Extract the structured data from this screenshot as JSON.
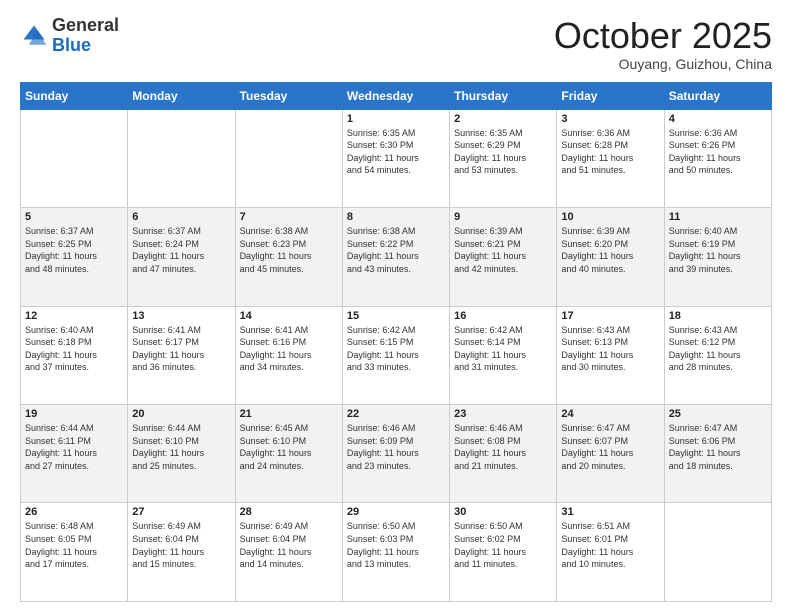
{
  "logo": {
    "general": "General",
    "blue": "Blue"
  },
  "header": {
    "month": "October 2025",
    "location": "Ouyang, Guizhou, China"
  },
  "days_of_week": [
    "Sunday",
    "Monday",
    "Tuesday",
    "Wednesday",
    "Thursday",
    "Friday",
    "Saturday"
  ],
  "weeks": [
    [
      {
        "day": "",
        "info": ""
      },
      {
        "day": "",
        "info": ""
      },
      {
        "day": "",
        "info": ""
      },
      {
        "day": "1",
        "info": "Sunrise: 6:35 AM\nSunset: 6:30 PM\nDaylight: 11 hours\nand 54 minutes."
      },
      {
        "day": "2",
        "info": "Sunrise: 6:35 AM\nSunset: 6:29 PM\nDaylight: 11 hours\nand 53 minutes."
      },
      {
        "day": "3",
        "info": "Sunrise: 6:36 AM\nSunset: 6:28 PM\nDaylight: 11 hours\nand 51 minutes."
      },
      {
        "day": "4",
        "info": "Sunrise: 6:36 AM\nSunset: 6:26 PM\nDaylight: 11 hours\nand 50 minutes."
      }
    ],
    [
      {
        "day": "5",
        "info": "Sunrise: 6:37 AM\nSunset: 6:25 PM\nDaylight: 11 hours\nand 48 minutes."
      },
      {
        "day": "6",
        "info": "Sunrise: 6:37 AM\nSunset: 6:24 PM\nDaylight: 11 hours\nand 47 minutes."
      },
      {
        "day": "7",
        "info": "Sunrise: 6:38 AM\nSunset: 6:23 PM\nDaylight: 11 hours\nand 45 minutes."
      },
      {
        "day": "8",
        "info": "Sunrise: 6:38 AM\nSunset: 6:22 PM\nDaylight: 11 hours\nand 43 minutes."
      },
      {
        "day": "9",
        "info": "Sunrise: 6:39 AM\nSunset: 6:21 PM\nDaylight: 11 hours\nand 42 minutes."
      },
      {
        "day": "10",
        "info": "Sunrise: 6:39 AM\nSunset: 6:20 PM\nDaylight: 11 hours\nand 40 minutes."
      },
      {
        "day": "11",
        "info": "Sunrise: 6:40 AM\nSunset: 6:19 PM\nDaylight: 11 hours\nand 39 minutes."
      }
    ],
    [
      {
        "day": "12",
        "info": "Sunrise: 6:40 AM\nSunset: 6:18 PM\nDaylight: 11 hours\nand 37 minutes."
      },
      {
        "day": "13",
        "info": "Sunrise: 6:41 AM\nSunset: 6:17 PM\nDaylight: 11 hours\nand 36 minutes."
      },
      {
        "day": "14",
        "info": "Sunrise: 6:41 AM\nSunset: 6:16 PM\nDaylight: 11 hours\nand 34 minutes."
      },
      {
        "day": "15",
        "info": "Sunrise: 6:42 AM\nSunset: 6:15 PM\nDaylight: 11 hours\nand 33 minutes."
      },
      {
        "day": "16",
        "info": "Sunrise: 6:42 AM\nSunset: 6:14 PM\nDaylight: 11 hours\nand 31 minutes."
      },
      {
        "day": "17",
        "info": "Sunrise: 6:43 AM\nSunset: 6:13 PM\nDaylight: 11 hours\nand 30 minutes."
      },
      {
        "day": "18",
        "info": "Sunrise: 6:43 AM\nSunset: 6:12 PM\nDaylight: 11 hours\nand 28 minutes."
      }
    ],
    [
      {
        "day": "19",
        "info": "Sunrise: 6:44 AM\nSunset: 6:11 PM\nDaylight: 11 hours\nand 27 minutes."
      },
      {
        "day": "20",
        "info": "Sunrise: 6:44 AM\nSunset: 6:10 PM\nDaylight: 11 hours\nand 25 minutes."
      },
      {
        "day": "21",
        "info": "Sunrise: 6:45 AM\nSunset: 6:10 PM\nDaylight: 11 hours\nand 24 minutes."
      },
      {
        "day": "22",
        "info": "Sunrise: 6:46 AM\nSunset: 6:09 PM\nDaylight: 11 hours\nand 23 minutes."
      },
      {
        "day": "23",
        "info": "Sunrise: 6:46 AM\nSunset: 6:08 PM\nDaylight: 11 hours\nand 21 minutes."
      },
      {
        "day": "24",
        "info": "Sunrise: 6:47 AM\nSunset: 6:07 PM\nDaylight: 11 hours\nand 20 minutes."
      },
      {
        "day": "25",
        "info": "Sunrise: 6:47 AM\nSunset: 6:06 PM\nDaylight: 11 hours\nand 18 minutes."
      }
    ],
    [
      {
        "day": "26",
        "info": "Sunrise: 6:48 AM\nSunset: 6:05 PM\nDaylight: 11 hours\nand 17 minutes."
      },
      {
        "day": "27",
        "info": "Sunrise: 6:49 AM\nSunset: 6:04 PM\nDaylight: 11 hours\nand 15 minutes."
      },
      {
        "day": "28",
        "info": "Sunrise: 6:49 AM\nSunset: 6:04 PM\nDaylight: 11 hours\nand 14 minutes."
      },
      {
        "day": "29",
        "info": "Sunrise: 6:50 AM\nSunset: 6:03 PM\nDaylight: 11 hours\nand 13 minutes."
      },
      {
        "day": "30",
        "info": "Sunrise: 6:50 AM\nSunset: 6:02 PM\nDaylight: 11 hours\nand 11 minutes."
      },
      {
        "day": "31",
        "info": "Sunrise: 6:51 AM\nSunset: 6:01 PM\nDaylight: 11 hours\nand 10 minutes."
      },
      {
        "day": "",
        "info": ""
      }
    ]
  ]
}
